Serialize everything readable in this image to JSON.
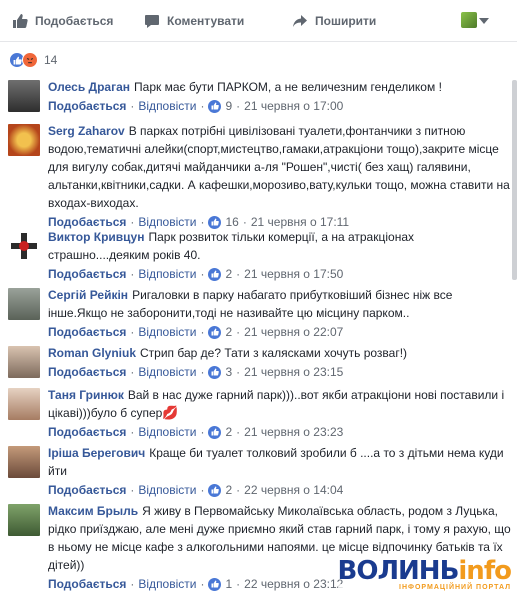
{
  "actions": {
    "like_label": "Подобається",
    "comment_label": "Коментувати",
    "share_label": "Поширити"
  },
  "reactions": {
    "count": "14"
  },
  "labels": {
    "like": "Подобається",
    "reply": "Відповісти",
    "sep": "·"
  },
  "comments": [
    {
      "author": "Олесь Драган",
      "text": "Парк має бути ПАРКОМ, а не величезним генделиком !",
      "likes": "9",
      "time": "21 червня о 17:00",
      "heart": ""
    },
    {
      "author": "Serg Zaharov",
      "text": "В парках потрібні цивілізовані туалети,фонтанчики з питною водою,тематичні алейки(спорт,мистецтво,гамаки,атракціони тощо),закрите місце для вигулу собак,дитячі майданчики а-ля \"Рошен\",чисті( без хащ) галявини, альтанки,квітники,садки. А кафешки,морозиво,вату,кульки тощо, можна ставити на входах-виходах.",
      "likes": "16",
      "time": "21 червня о 17:11",
      "heart": ""
    },
    {
      "author": "Виктор Кривцун",
      "text": "Парк розвиток тільки комерції, а на атракціонах страшно....деяким років 40.",
      "likes": "2",
      "time": "21 червня о 17:50",
      "heart": ""
    },
    {
      "author": "Сергій Рейкін",
      "text": "Ригаловки в парку набагато прибутковіший бізнес ніж все інше.Якщо не заборонити,тоді не називайте цю місцину парком..",
      "likes": "2",
      "time": "21 червня о 22:07",
      "heart": ""
    },
    {
      "author": "Roman Glyniuk",
      "text": "Стрип бар де? Тати з калясками хочуть розваг!)",
      "likes": "3",
      "time": "21 червня о 23:15",
      "heart": ""
    },
    {
      "author": "Таня Гринюк",
      "text": "Вай в нас дуже гарний парк)))..вот якби атракціони нові поставили і цікаві)))було б супер",
      "likes": "2",
      "time": "21 червня о 23:23",
      "heart": "💋"
    },
    {
      "author": "Іріша Берегович",
      "text": "Краще би туалет толковий зробили б ....а то з дітьми нема куди йти",
      "likes": "2",
      "time": "22 червня о 14:04",
      "heart": ""
    },
    {
      "author": "Максим Брыль",
      "text": "Я живу в Первомайську Миколаївська область, родом з Луцька, рідко приїзджаю, але мені дуже приємно який став гарний парк, і тому я рахую, що в ньому не місце кафе з алкогольними напоями. це місце відпочинку батьків та їх дітей))",
      "likes": "1",
      "time": "22 червня о 23:12",
      "heart": ""
    }
  ],
  "watermark": {
    "main_a": "ВОЛИНЬ",
    "main_b": "info",
    "sub": "ІНФОРМАЦІЙНИЙ ПОРТАЛ"
  }
}
